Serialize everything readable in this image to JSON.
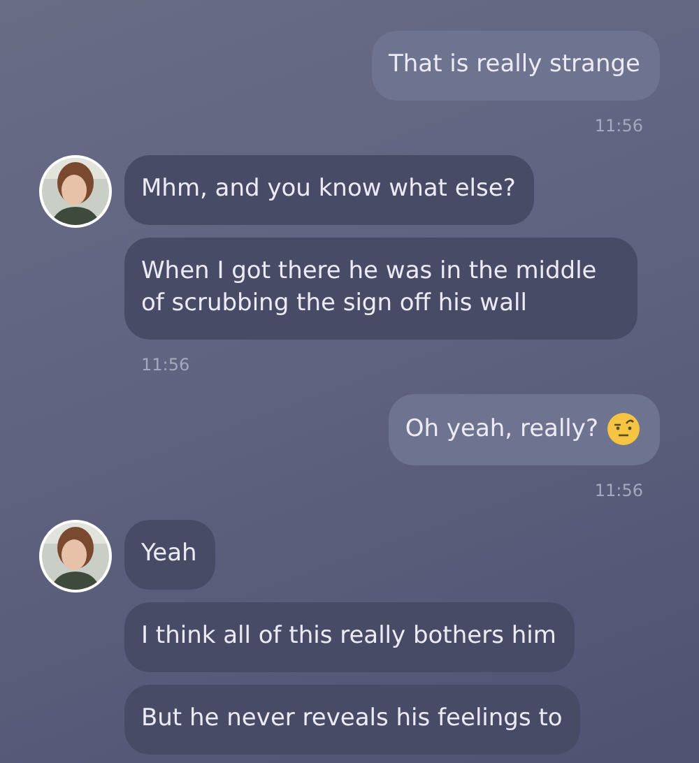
{
  "groups": [
    {
      "kind": "outgoing",
      "messages": [
        {
          "text": "That is really strange",
          "has_emoji": false
        }
      ],
      "time": "11:56"
    },
    {
      "kind": "incoming",
      "messages": [
        {
          "text": "Mhm, and you know what else?",
          "has_emoji": false
        },
        {
          "text": "When I got there he was in the middle of scrubbing the sign off his wall",
          "has_emoji": false
        }
      ],
      "time": "11:56"
    },
    {
      "kind": "outgoing",
      "messages": [
        {
          "text": "Oh yeah, really?",
          "has_emoji": true
        }
      ],
      "time": "11:56"
    },
    {
      "kind": "incoming",
      "messages": [
        {
          "text": "Yeah",
          "has_emoji": false
        },
        {
          "text": "I think all of this really bothers him",
          "has_emoji": false
        },
        {
          "text": "But he never reveals his feelings to",
          "has_emoji": false
        }
      ]
    }
  ]
}
